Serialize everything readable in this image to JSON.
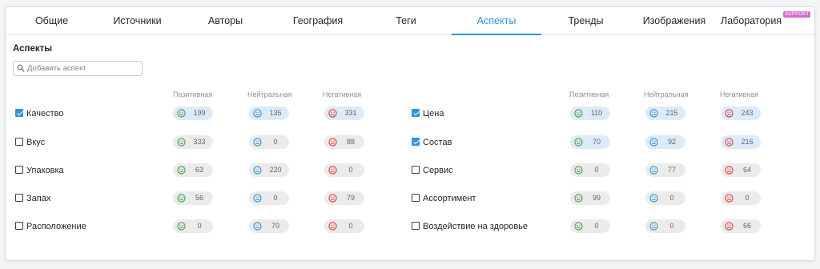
{
  "tabs": [
    {
      "label": "Общие",
      "active": false
    },
    {
      "label": "Источники",
      "active": false
    },
    {
      "label": "Авторы",
      "active": false
    },
    {
      "label": "География",
      "active": false
    },
    {
      "label": "Теги",
      "active": false
    },
    {
      "label": "Аспекты",
      "active": true
    },
    {
      "label": "Тренды",
      "active": false
    },
    {
      "label": "Изображения",
      "active": false
    },
    {
      "label": "Лаборатория",
      "active": false,
      "badge": "SUPPORT"
    }
  ],
  "aspects_section": {
    "title": "Аспекты",
    "search_placeholder": "Добавить аспект"
  },
  "column_headers": {
    "positive": "Позитивная",
    "neutral": "Нейтральная",
    "negative": "Негативная"
  },
  "colors": {
    "accent": "#2e93d8",
    "positive_face": "#43a047",
    "neutral_face": "#2e93d8",
    "negative_face": "#e53935",
    "badge": "#d36fcf",
    "pill_default": "#ebebec",
    "pill_highlight": "#dcebf9"
  },
  "aspects_left": [
    {
      "name": "Качество",
      "checked": true,
      "positive": "199",
      "neutral": "135",
      "negative": "331"
    },
    {
      "name": "Вкус",
      "checked": false,
      "positive": "333",
      "neutral": "0",
      "negative": "88"
    },
    {
      "name": "Упаковка",
      "checked": false,
      "positive": "63",
      "neutral": "220",
      "negative": "0"
    },
    {
      "name": "Запах",
      "checked": false,
      "positive": "56",
      "neutral": "0",
      "negative": "79"
    },
    {
      "name": "Расположение",
      "checked": false,
      "positive": "0",
      "neutral": "70",
      "negative": "0"
    }
  ],
  "aspects_right": [
    {
      "name": "Цена",
      "checked": true,
      "positive": "110",
      "neutral": "215",
      "negative": "243"
    },
    {
      "name": "Состав",
      "checked": true,
      "positive": "70",
      "neutral": "92",
      "negative": "216"
    },
    {
      "name": "Сервис",
      "checked": false,
      "positive": "0",
      "neutral": "77",
      "negative": "64"
    },
    {
      "name": "Ассортимент",
      "checked": false,
      "positive": "99",
      "neutral": "0",
      "negative": "0"
    },
    {
      "name": "Воздействие на здоровье",
      "checked": false,
      "positive": "0",
      "neutral": "0",
      "negative": "66"
    }
  ]
}
